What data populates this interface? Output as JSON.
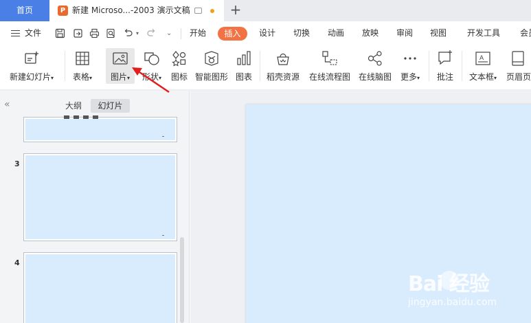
{
  "tabs": {
    "home": "首页",
    "document": "新建 Microso...-2003 演示文稿",
    "doc_icon_letter": "P",
    "add": "+"
  },
  "menu": {
    "file": "文件",
    "items": [
      "开始",
      "插入",
      "设计",
      "切换",
      "动画",
      "放映",
      "审阅",
      "视图",
      "开发工具",
      "会员"
    ],
    "active": "插入"
  },
  "ribbon": {
    "new_slide": "新建幻灯片",
    "table": "表格",
    "picture": "图片",
    "shape": "形状",
    "icons": "图标",
    "smart_graphic": "智能图形",
    "chart": "图表",
    "docer": "稻壳资源",
    "flowchart": "在线流程图",
    "mindmap": "在线脑图",
    "more": "更多",
    "comment": "批注",
    "textbox": "文本框",
    "header_footer": "页眉页"
  },
  "panel": {
    "collapse": "«",
    "outline_tab": "大纲",
    "slides_tab": "幻灯片",
    "slide_numbers": [
      "3",
      "4"
    ]
  },
  "watermark": {
    "logo": "Bai  经验",
    "url": "jingyan.baidu.com"
  },
  "colors": {
    "accent_blue": "#4a7fe6",
    "insert_orange": "#f27243",
    "slide_fill": "#d9ecfd",
    "arrow_red": "#e02020"
  }
}
